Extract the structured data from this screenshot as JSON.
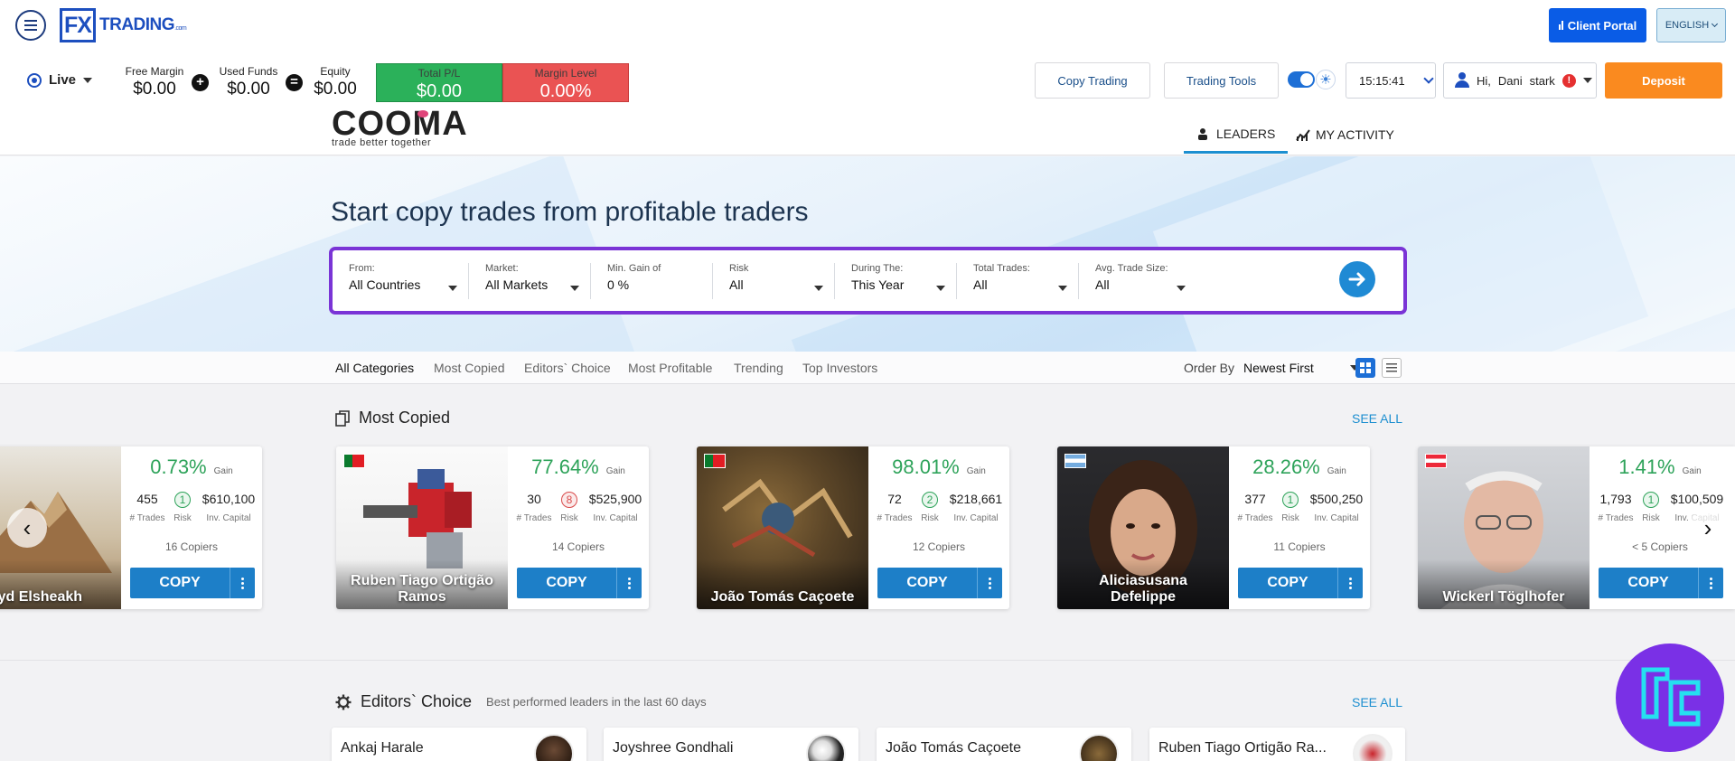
{
  "header": {
    "brand_mark": "FX",
    "brand_name": "TRADING",
    "brand_suffix": ".com",
    "client_portal": "Client Portal",
    "language": "ENGLISH"
  },
  "account": {
    "mode": "Live",
    "free_margin_label": "Free Margin",
    "free_margin": "$0.00",
    "used_funds_label": "Used Funds",
    "used_funds": "$0.00",
    "equity_label": "Equity",
    "equity": "$0.00",
    "total_pl_label": "Total P/L",
    "total_pl": "$0.00",
    "margin_level_label": "Margin Level",
    "margin_level": "0.00%"
  },
  "toolbar": {
    "copy_trading": "Copy Trading",
    "trading_tools": "Trading Tools",
    "time": "15:15:41",
    "greeting": "Hi,",
    "user_name": "Dani",
    "user_last": "stark",
    "alert": "!",
    "deposit": "Deposit"
  },
  "cooma": {
    "wordmark_a": "COOM",
    "wordmark_b": "A",
    "tagline": "trade better together"
  },
  "tabs": [
    {
      "label": "LEADERS",
      "active": true
    },
    {
      "label": "MY ACTIVITY",
      "active": false
    }
  ],
  "hero": {
    "title": "Start copy trades from profitable traders"
  },
  "filters": [
    {
      "label": "From:",
      "value": "All Countries"
    },
    {
      "label": "Market:",
      "value": "All Markets"
    },
    {
      "label": "Min. Gain of",
      "value": "0 %"
    },
    {
      "label": "Risk",
      "value": "All"
    },
    {
      "label": "During The:",
      "value": "This Year"
    },
    {
      "label": "Total Trades:",
      "value": "All"
    },
    {
      "label": "Avg. Trade Size:",
      "value": "All"
    }
  ],
  "categories": [
    "All Categories",
    "Most Copied",
    "Editors` Choice",
    "Most Profitable",
    "Trending",
    "Top Investors"
  ],
  "order": {
    "label": "Order By",
    "value": "Newest First"
  },
  "most_copied": {
    "title": "Most Copied",
    "see_all": "SEE ALL",
    "cards": [
      {
        "name": "Eyd Elsheakh",
        "gain": "0.73%",
        "gain_label": "Gain",
        "trades": "455",
        "risk": "1",
        "capital": "$610,100",
        "copiers": "16 Copiers",
        "copy": "COPY"
      },
      {
        "name": "Ruben Tiago Ortigão Ramos",
        "gain": "77.64%",
        "gain_label": "Gain",
        "trades": "30",
        "risk": "8",
        "capital": "$525,900",
        "copiers": "14 Copiers",
        "copy": "COPY"
      },
      {
        "name": "João Tomás Caçoete",
        "gain": "98.01%",
        "gain_label": "Gain",
        "trades": "72",
        "risk": "2",
        "capital": "$218,661",
        "copiers": "12 Copiers",
        "copy": "COPY"
      },
      {
        "name": "Aliciasusana Defelippe",
        "gain": "28.26%",
        "gain_label": "Gain",
        "trades": "377",
        "risk": "1",
        "capital": "$500,250",
        "copiers": "11 Copiers",
        "copy": "COPY"
      },
      {
        "name": "Wickerl Töglhofer",
        "gain": "1.41%",
        "gain_label": "Gain",
        "trades": "1,793",
        "risk": "1",
        "capital": "$100,509",
        "copiers": "< 5 Copiers",
        "copy": "COPY"
      }
    ],
    "labels": {
      "trades": "# Trades",
      "risk": "Risk",
      "capital": "Inv. Capital"
    }
  },
  "editors_choice": {
    "title": "Editors` Choice",
    "subtitle": "Best performed leaders in the last 60 days",
    "see_all": "SEE ALL",
    "cards": [
      "Ankaj Harale",
      "Joyshree Gondhali",
      "João Tomás Caçoete",
      "Ruben Tiago Ortigão Ra..."
    ]
  },
  "colors": {
    "gain": "#2ea35a",
    "profit_box": "#2bb15a",
    "loss_box": "#ea5353",
    "accent": "#1d7fc8",
    "filter_border": "#7a34d6",
    "deposit": "#fa8a1f"
  }
}
